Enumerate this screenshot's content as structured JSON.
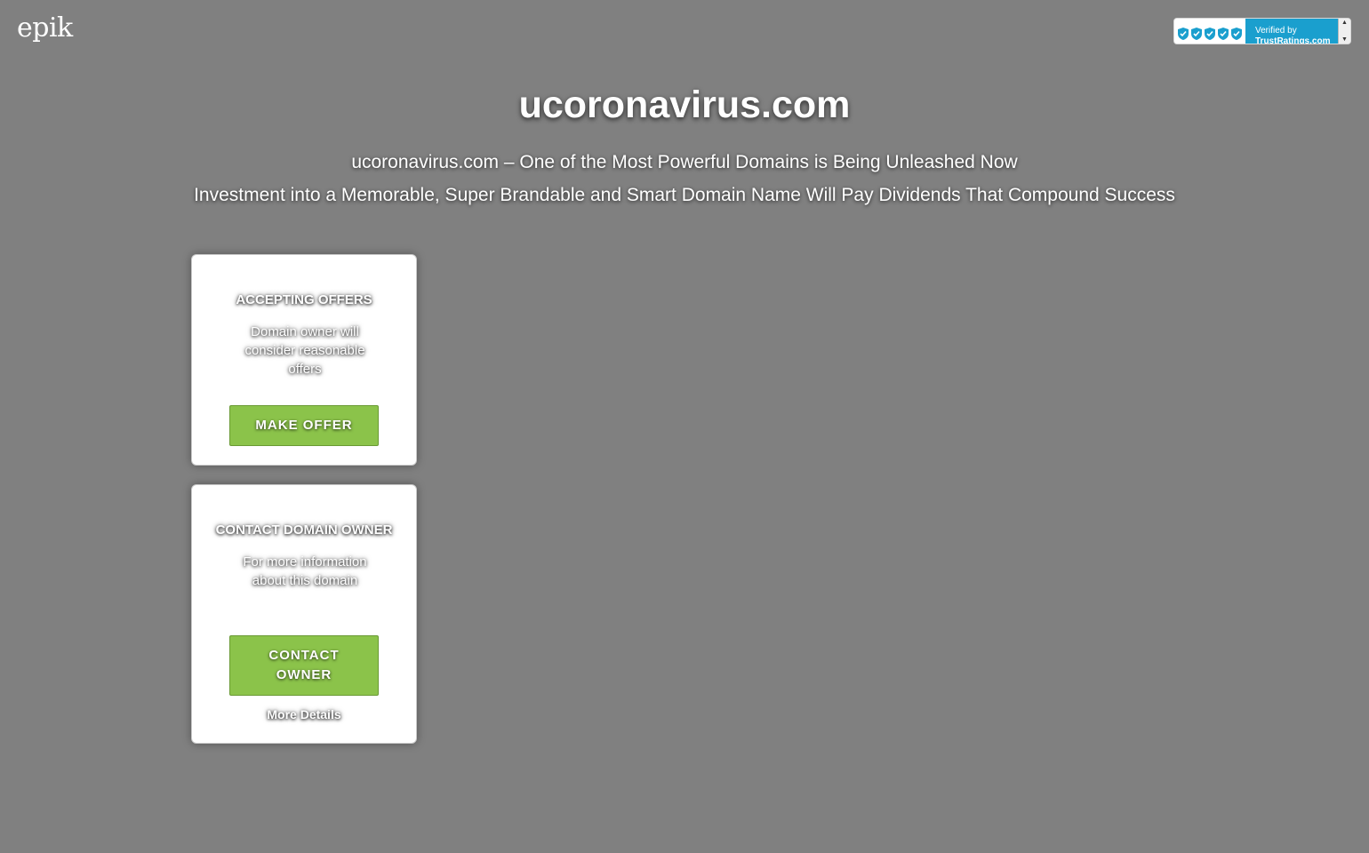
{
  "header": {
    "logo": "epik",
    "trust_badge": {
      "line1": "Verified by",
      "line2": "TrustRatings.com",
      "shield_count": 5,
      "shield_color": "#1a9fce"
    }
  },
  "main": {
    "domain": "ucoronavirus.com",
    "tagline_1": "ucoronavirus.com – One of the Most Powerful Domains is Being Unleashed Now",
    "tagline_2": "Investment into a Memorable, Super Brandable and Smart Domain Name Will Pay Dividends That Compound Success"
  },
  "cards": {
    "offer": {
      "title": "ACCEPTING OFFERS",
      "description": "Domain owner will consider reasonable offers",
      "button_label": "MAKE OFFER"
    },
    "contact": {
      "title": "CONTACT DOMAIN OWNER",
      "description": "For more information about this domain",
      "button_label": "CONTACT OWNER",
      "link_label": "More Details"
    }
  },
  "colors": {
    "background": "#808080",
    "button": "#8bc34a",
    "card": "#ffffff"
  }
}
